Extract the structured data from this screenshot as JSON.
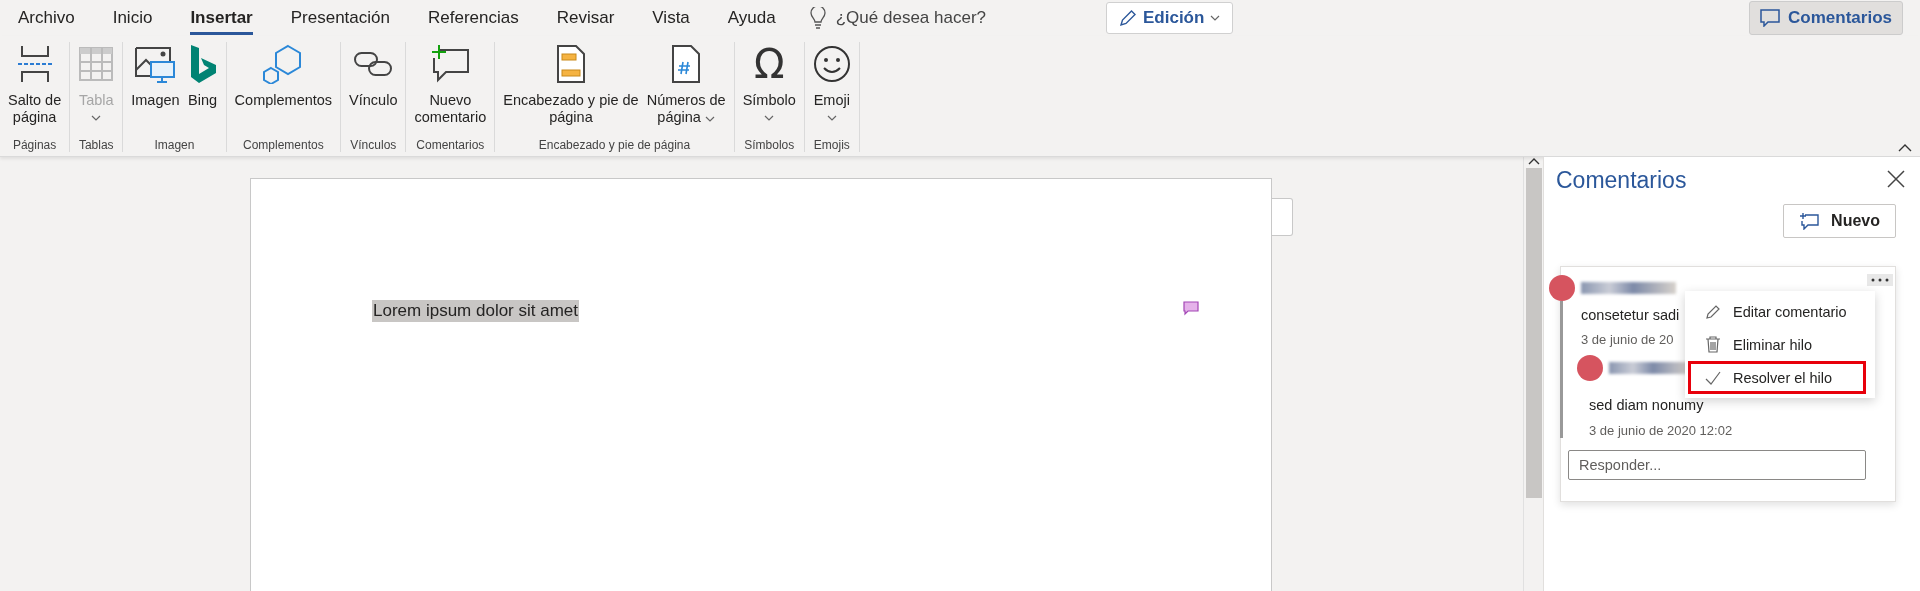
{
  "menu_tabs": [
    {
      "label": "Archivo",
      "selected": false
    },
    {
      "label": "Inicio",
      "selected": false
    },
    {
      "label": "Insertar",
      "selected": true
    },
    {
      "label": "Presentación",
      "selected": false
    },
    {
      "label": "Referencias",
      "selected": false
    },
    {
      "label": "Revisar",
      "selected": false
    },
    {
      "label": "Vista",
      "selected": false
    },
    {
      "label": "Ayuda",
      "selected": false
    }
  ],
  "tell_me": {
    "placeholder": "¿Qué desea hacer?"
  },
  "mode_button": {
    "label": "Edición"
  },
  "comments_button": {
    "label": "Comentarios",
    "selected": true
  },
  "ribbon": [
    {
      "label": "Páginas",
      "buttons": [
        {
          "kind": "pagebreak",
          "lines": [
            "Salto de",
            "página"
          ],
          "disabled": false,
          "dropdown": false
        }
      ]
    },
    {
      "label": "Tablas",
      "buttons": [
        {
          "kind": "table",
          "lines": [
            "Tabla"
          ],
          "disabled": true,
          "dropdown": true
        }
      ]
    },
    {
      "label": "Imagen",
      "buttons": [
        {
          "kind": "image",
          "lines": [
            "Imagen"
          ],
          "disabled": false,
          "dropdown": false
        },
        {
          "kind": "bing",
          "lines": [
            "Bing"
          ],
          "disabled": false,
          "dropdown": false
        }
      ]
    },
    {
      "label": "Complementos",
      "buttons": [
        {
          "kind": "addins",
          "lines": [
            "Complementos"
          ],
          "disabled": false,
          "dropdown": false
        }
      ]
    },
    {
      "label": "Vínculos",
      "buttons": [
        {
          "kind": "link",
          "lines": [
            "Vínculo"
          ],
          "disabled": false,
          "dropdown": false
        }
      ]
    },
    {
      "label": "Comentarios",
      "buttons": [
        {
          "kind": "comment",
          "lines": [
            "Nuevo",
            "comentario"
          ],
          "disabled": false,
          "dropdown": false
        }
      ]
    },
    {
      "label": "Encabezado y pie de página",
      "buttons": [
        {
          "kind": "header",
          "lines": [
            "Encabezado y pie de",
            "página"
          ],
          "disabled": false,
          "dropdown": false
        },
        {
          "kind": "pagenumber",
          "lines": [
            "Números de",
            "página"
          ],
          "disabled": false,
          "dropdown": true
        }
      ]
    },
    {
      "label": "Símbolos",
      "buttons": [
        {
          "kind": "glyph",
          "glyph": "Ω",
          "lines": [
            "Símbolo"
          ],
          "disabled": false,
          "dropdown": true
        }
      ]
    },
    {
      "label": "Emojis",
      "buttons": [
        {
          "kind": "smiley",
          "lines": [
            "Emoji"
          ],
          "disabled": false,
          "dropdown": true
        }
      ]
    }
  ],
  "document": {
    "text": "Lorem ipsum dolor sit amet",
    "highlighted": true
  },
  "comments_pane": {
    "title": "Comentarios",
    "new_button": {
      "label": "Nuevo"
    },
    "thread": {
      "comment": {
        "text": "consetetur sadi",
        "time": "3 de junio de 20"
      },
      "reply": {
        "text": "sed diam nonumy",
        "time": "3 de junio de 2020 12:02"
      },
      "reply_field": {
        "placeholder": "Responder..."
      },
      "menu": [
        {
          "kind": "edit",
          "label": "Editar comentario",
          "highlighted": false
        },
        {
          "kind": "delete",
          "label": "Eliminar hilo",
          "highlighted": false
        },
        {
          "kind": "resolve",
          "label": "Resolver el hilo",
          "highlighted": true
        }
      ]
    }
  }
}
